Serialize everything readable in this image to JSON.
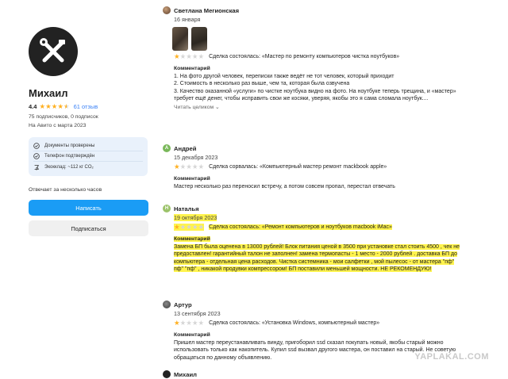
{
  "profile": {
    "name": "Михаил",
    "rating": "4.4",
    "stars": [
      1,
      1,
      1,
      1,
      0.5
    ],
    "reviews_link": "61 отзыв",
    "subscribers": "75 подписчиков, 0 подписок",
    "since": "На Авито с марта 2023",
    "verifications": [
      {
        "icon": "document-check-icon",
        "label": "Документы проверены"
      },
      {
        "icon": "phone-check-icon",
        "label": "Телефон подтверждён"
      },
      {
        "icon": "eco-icon",
        "label": "Экокклад: ~112 кг CO₂"
      }
    ],
    "answer_time": "Отвечает за несколько часов",
    "write_button": "Написать",
    "subscribe_button": "Подписаться"
  },
  "reviews": [
    {
      "author": "Светлана Мегионская",
      "date": "16 января",
      "rating": 1,
      "deal": "Сделка состоялась: «Мастер по ремонту компьютеров чистка ноутбуков»",
      "comment_label": "Комментарий",
      "text": "1. На фото другой человек, переписки также ведёт не тот человек, который приходит\n2. Стоимость в несколько раз выше, чем та, которая была озвучена\n3. Качество оказанной «услуги» по чистке ноутбука видно на фото. На ноутбуке теперь трещина, и «мастер» требует ещё денег, чтобы исправить свои же косяки, уверяя, якобы это я сама сломала ноутбук....",
      "read_more": "Читать целиком ⌄"
    },
    {
      "author": "Андрей",
      "date": "15 декабря 2023",
      "rating": 1,
      "deal": "Сделка сорвалась: «Компьютерный мастер ремонт mackbook apple»",
      "comment_label": "Комментарий",
      "text": "Мастер несколько раз переносил встречу, а потом совсем пропал, перестал отвечать"
    },
    {
      "author": "Наталья",
      "date": "19 октября 2023",
      "rating": 1,
      "deal": "Сделка состоялась: «Ремонт компьютеров и ноутбуков macbook iMac»",
      "comment_label": "Комментарий",
      "text": "Замена БП была оценена в 13000 рублей! Блок питания ценой в 3500 при установке стал стоить 4500 , чек не предоставлен! гарантийный талон не заполнен! замена термопасты - 1 место - 2000 рублей . доставка БП до компьютера - отдельная цена расходов. Чистка системника - мои салфетки , мой пылесос - от мастера \"пф\" пф\" \"пф\" , никакой продувки компрессором! БП поставили меньшей мощности. НЕ РЕКОМЕНДУЮ!"
    },
    {
      "author": "Артур",
      "date": "13 сентября 2023",
      "rating": 1,
      "deal": "Сделка состоялась: «Установка Windows, компьютерный мастер»",
      "comment_label": "Комментарий",
      "text": "Пришел мастер переустанавливать винду, пригоборил ssd сказал покупать новый, якобы старый можно использовать только как накопитель. Купил ssd вызвал другого мастера, он поставил на старый. Не советую обращаться по данному объявлению."
    },
    {
      "author": "Михаил"
    }
  ],
  "watermark": "YAPLAKAL.COM",
  "colors": {
    "accent": "#1a9cf5",
    "star": "#ffb020",
    "highlight": "#fff34d",
    "link": "#3b82f6"
  }
}
